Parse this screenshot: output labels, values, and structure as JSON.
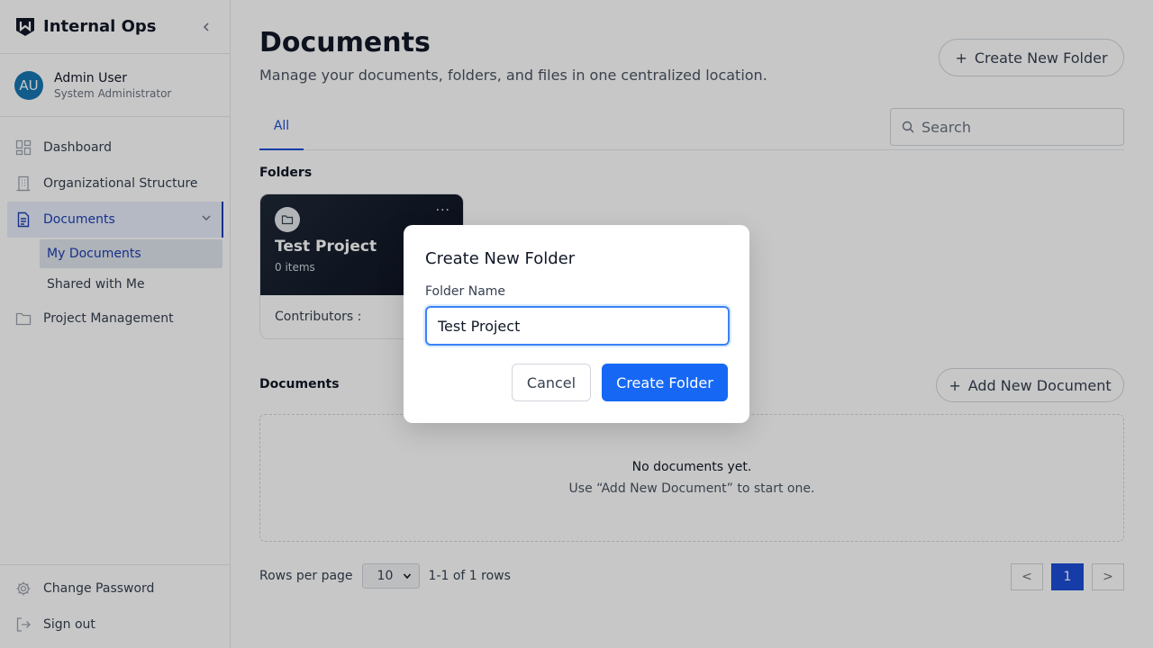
{
  "brand": {
    "name": "Internal Ops"
  },
  "user": {
    "initials": "AU",
    "name": "Admin User",
    "role": "System Administrator"
  },
  "nav": {
    "dashboard": "Dashboard",
    "org": "Organizational Structure",
    "documents": "Documents",
    "my_documents": "My Documents",
    "shared": "Shared with Me",
    "projects": "Project Management",
    "change_password": "Change Password",
    "sign_out": "Sign out"
  },
  "header": {
    "title": "Documents",
    "subtitle": "Manage your documents, folders, and files in one centralized location.",
    "create_folder": "Create New Folder"
  },
  "tabs": [
    "All"
  ],
  "search": {
    "placeholder": "Search"
  },
  "folders": {
    "label": "Folders",
    "items": [
      {
        "name": "Test Project",
        "count": "0 items",
        "contributors": "Contributors :",
        "more": "···"
      }
    ]
  },
  "documents": {
    "label": "Documents",
    "add_button": "Add New Document",
    "empty_title": "No documents yet.",
    "empty_hint": "Use “Add New Document” to start one."
  },
  "pagination": {
    "rows_label": "Rows per page",
    "rows_value": "10",
    "range": "1-1 of 1 rows",
    "prev": "<",
    "current": "1",
    "next": ">"
  },
  "modal": {
    "title": "Create New Folder",
    "field_label": "Folder Name",
    "field_value": "Test Project",
    "cancel": "Cancel",
    "submit": "Create Folder"
  },
  "colors": {
    "accent": "#1668f4",
    "active_nav": "#1d3fb0",
    "avatar": "#1677b3"
  }
}
